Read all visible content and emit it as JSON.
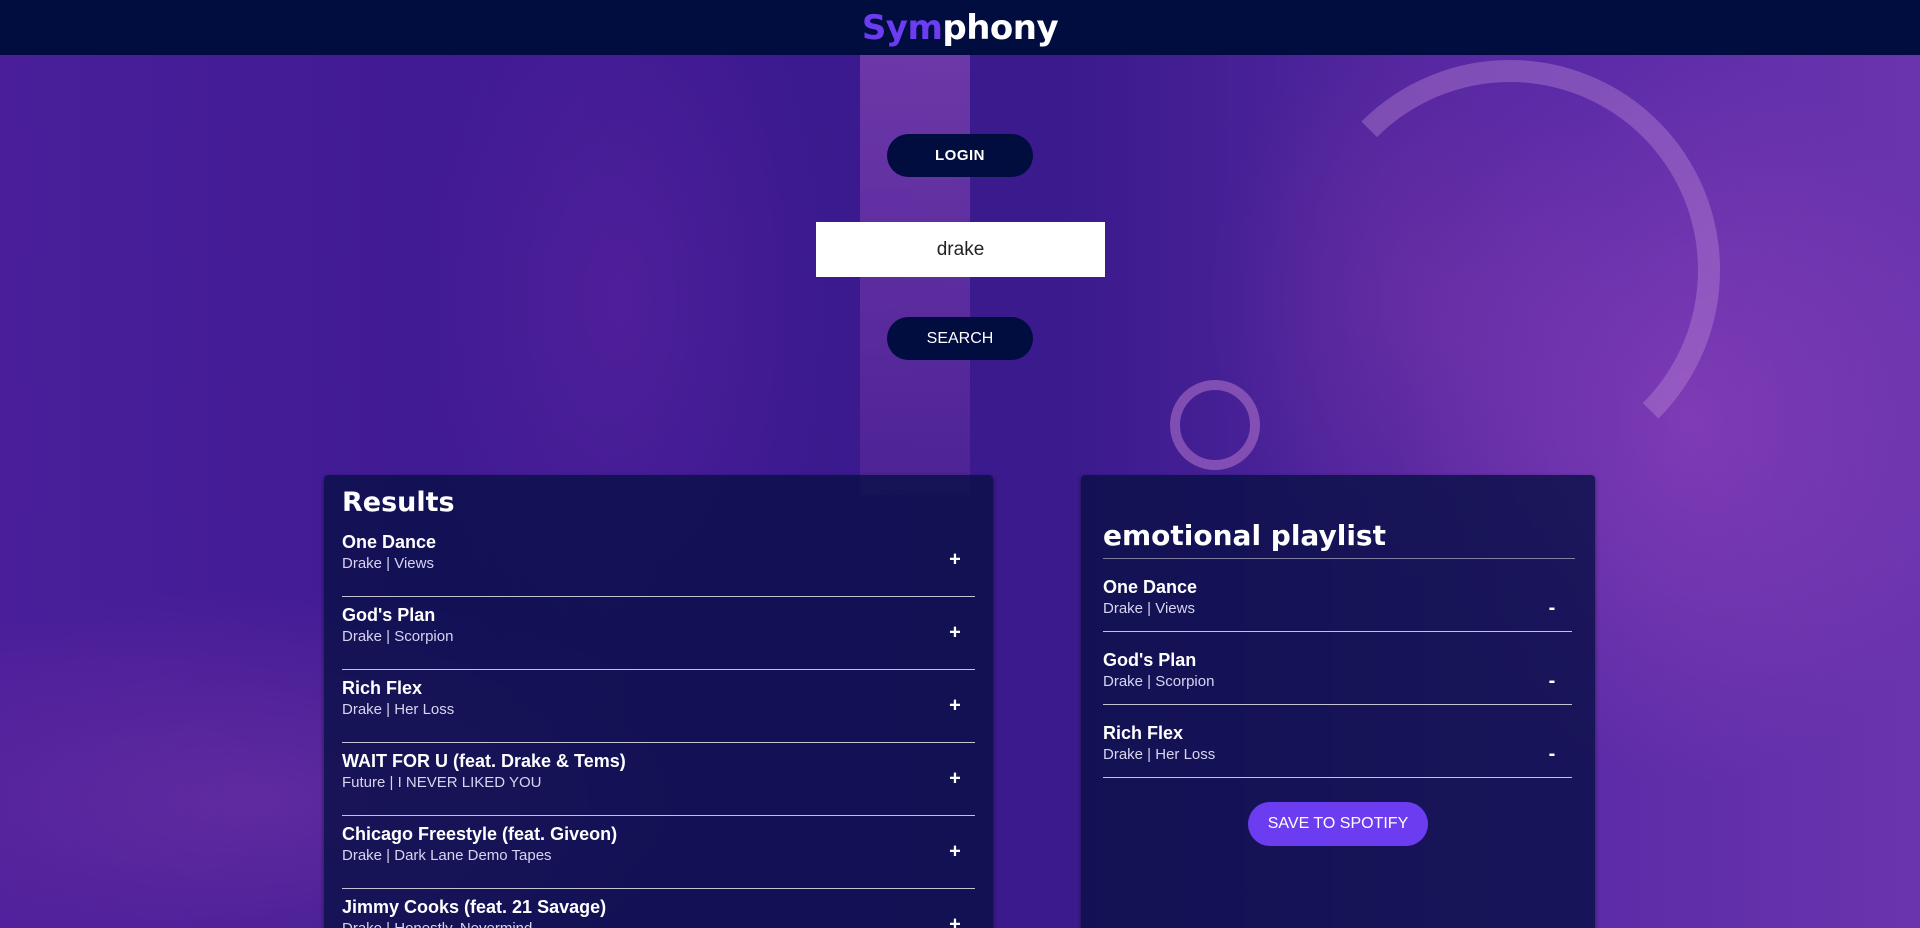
{
  "header": {
    "brand_part1": "Sym",
    "brand_part2": "phony",
    "brand_accent_color": "#6c3df0",
    "bar_color": "#010c3f"
  },
  "controls": {
    "login_label": "LOGIN",
    "search_value": "drake",
    "search_label": "SEARCH"
  },
  "results": {
    "title": "Results",
    "add_symbol": "+",
    "tracks": [
      {
        "title": "One Dance",
        "meta": "Drake | Views"
      },
      {
        "title": "God's Plan",
        "meta": "Drake | Scorpion"
      },
      {
        "title": "Rich Flex",
        "meta": "Drake | Her Loss"
      },
      {
        "title": "WAIT FOR U (feat. Drake & Tems)",
        "meta": "Future | I NEVER LIKED YOU"
      },
      {
        "title": "Chicago Freestyle (feat. Giveon)",
        "meta": "Drake | Dark Lane Demo Tapes"
      },
      {
        "title": "Jimmy Cooks (feat. 21 Savage)",
        "meta": "Drake | Honestly, Nevermind"
      }
    ]
  },
  "playlist": {
    "name": "emotional playlist",
    "remove_symbol": "-",
    "tracks": [
      {
        "title": "One Dance",
        "meta": "Drake | Views"
      },
      {
        "title": "God's Plan",
        "meta": "Drake | Scorpion"
      },
      {
        "title": "Rich Flex",
        "meta": "Drake | Her Loss"
      }
    ],
    "save_label": "SAVE TO SPOTIFY",
    "save_color": "#6c3df0"
  }
}
